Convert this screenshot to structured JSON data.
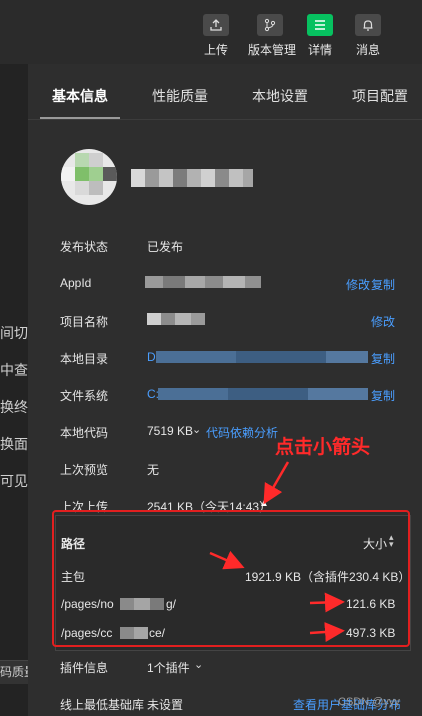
{
  "toolbar": {
    "upload_label": "上传",
    "version_label": "版本管理",
    "details_label": "详情",
    "messages_label": "消息"
  },
  "left_fragments": [
    "间切",
    "中查",
    "换终",
    "换面",
    "可见"
  ],
  "left_bottom_tab": "码质量",
  "tabs": [
    "基本信息",
    "性能质量",
    "本地设置",
    "项目配置"
  ],
  "info": {
    "publish_status_label": "发布状态",
    "publish_status_value": "已发布",
    "appid_label": "AppId",
    "appid_edit": "修改",
    "appid_copy": "复制",
    "project_name_label": "项目名称",
    "project_name_edit": "修改",
    "local_dir_label": "本地目录",
    "local_dir_value": "D",
    "local_dir_copy": "复制",
    "file_system_label": "文件系统",
    "file_system_value": "C:",
    "file_system_copy": "复制",
    "local_code_label": "本地代码",
    "local_code_value": "7519 KB",
    "local_code_link": "代码依赖分析",
    "last_preview_label": "上次预览",
    "last_preview_value": "无",
    "last_upload_label": "上次上传",
    "last_upload_value": "2541 KB（今天14:43）"
  },
  "size_table": {
    "path_header": "路径",
    "size_header": "大小",
    "rows": [
      {
        "path": "主包",
        "size": "1921.9 KB（含插件230.4 KB）"
      },
      {
        "path": "/pages/no",
        "path_tail": "g/",
        "size": "121.6 KB"
      },
      {
        "path": "/pages/cc",
        "path_tail": "ce/",
        "size": "497.3 KB"
      }
    ]
  },
  "plugin_label": "插件信息",
  "plugin_value": "1个插件",
  "base_lib_label": "线上最低基础库",
  "base_lib_value": "未设置",
  "base_lib_link": "查看用户基础库分布",
  "annotation": "点击小箭头",
  "watermark": "CSDN @yyy",
  "colors": {
    "accent": "#07c160",
    "link": "#4a9eff",
    "annotation": "#ff2a2a"
  }
}
